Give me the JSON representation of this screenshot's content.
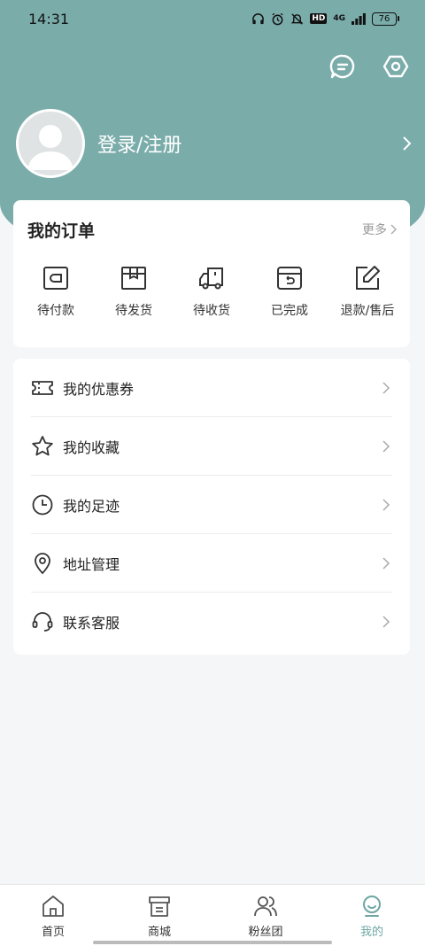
{
  "status_bar": {
    "time": "14:31",
    "network": "4G",
    "hd": "HD",
    "battery": "76",
    "icons": [
      "headphones-icon",
      "alarm-icon",
      "bell-off-icon",
      "hd-icon",
      "signal-icon",
      "battery-icon"
    ]
  },
  "header": {
    "actions": [
      "message-icon",
      "settings-icon"
    ],
    "accent_color": "#7aacaa"
  },
  "profile": {
    "login_label": "登录/注册"
  },
  "orders": {
    "title": "我的订单",
    "more_label": "更多",
    "items": [
      {
        "label": "待付款",
        "icon": "wallet-icon"
      },
      {
        "label": "待发货",
        "icon": "package-icon"
      },
      {
        "label": "待收货",
        "icon": "truck-icon"
      },
      {
        "label": "已完成",
        "icon": "completed-box-icon"
      },
      {
        "label": "退款/售后",
        "icon": "edit-icon"
      }
    ]
  },
  "menu": {
    "items": [
      {
        "label": "我的优惠券",
        "icon": "coupon-icon"
      },
      {
        "label": "我的收藏",
        "icon": "star-icon"
      },
      {
        "label": "我的足迹",
        "icon": "clock-icon"
      },
      {
        "label": "地址管理",
        "icon": "location-icon"
      },
      {
        "label": "联系客服",
        "icon": "headset-icon"
      }
    ]
  },
  "tabbar": {
    "active": "我的",
    "active_color": "#6ea6a3",
    "items": [
      {
        "label": "首页",
        "icon": "home-icon"
      },
      {
        "label": "商城",
        "icon": "shop-icon"
      },
      {
        "label": "粉丝团",
        "icon": "fans-icon"
      },
      {
        "label": "我的",
        "icon": "profile-icon"
      }
    ]
  }
}
